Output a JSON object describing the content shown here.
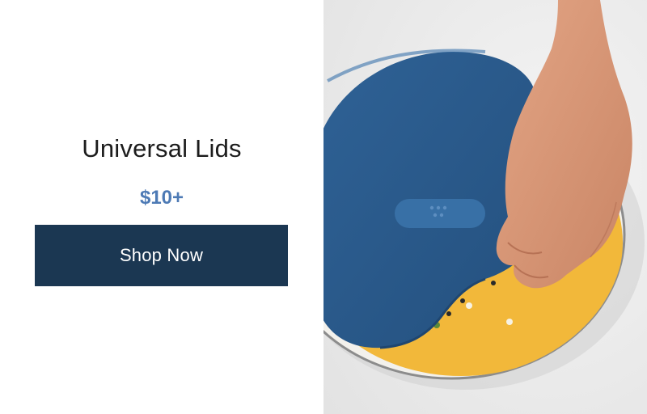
{
  "product": {
    "title": "Universal Lids",
    "price": "$10+",
    "cta_label": "Shop Now"
  },
  "colors": {
    "button_bg": "#1b3752",
    "price": "#4d7ab5",
    "lid": "#2c5d8e",
    "soup": "#f2b83a"
  }
}
